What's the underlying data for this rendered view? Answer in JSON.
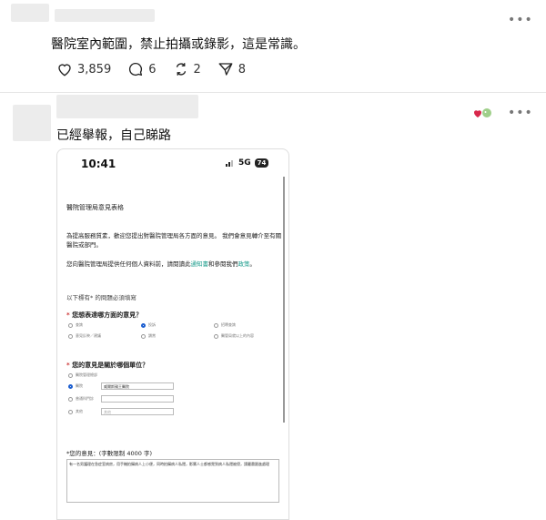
{
  "comment1": {
    "text": "醫院室內範圍，禁止拍攝或錄影，這是常識。",
    "more": "•••",
    "likes": "3,859",
    "replies": "6",
    "reposts": "2",
    "shares": "8"
  },
  "comment2": {
    "text": "已經舉報，自己睇路",
    "more": "•••",
    "screenshot": {
      "time": "10:41",
      "network": "5G",
      "battery": "74",
      "form_title": "醫院管理局意見表格",
      "intro": "為提高服務質素，歡迎您提出對醫院管理局各方面的意見。 我們會意見轉介至有關醫院或部門。",
      "privacy_prefix": "您向醫院管理局提供任何個人資料前，請閱讀此",
      "privacy_link1": "通知書",
      "privacy_mid": "和參閱我們",
      "privacy_link2": "政策",
      "privacy_suffix": "。",
      "required_note": "以下標有* 的問題必須填寫",
      "q1": "您想表達哪方面的意見？",
      "q1_options": [
        "查詢",
        "投訴",
        "招聘查詢",
        "意見反映／建議",
        "讚賞",
        "醫管局就以上的內容"
      ],
      "q2": "您的意見是關於哪個單位？",
      "q2_options": [
        "醫院管理總部",
        "醫院",
        "普通科門診",
        "其他"
      ],
      "q2_hospital_value": "威爾斯親王醫院",
      "q2_other_placeholder": "其他",
      "q3_label": "*您的意見：(字數限制 4000 字)",
      "q3_value": "有一名男護理在急症室病房，用手機拍攝病人上小便，同時拍攝病人私隱，影響人士都感覺到病人私隱被侵，請嚴肅跟進處理"
    }
  },
  "colors": {
    "accent": "#1a9c8c",
    "radio_on": "#1d5fd0"
  }
}
